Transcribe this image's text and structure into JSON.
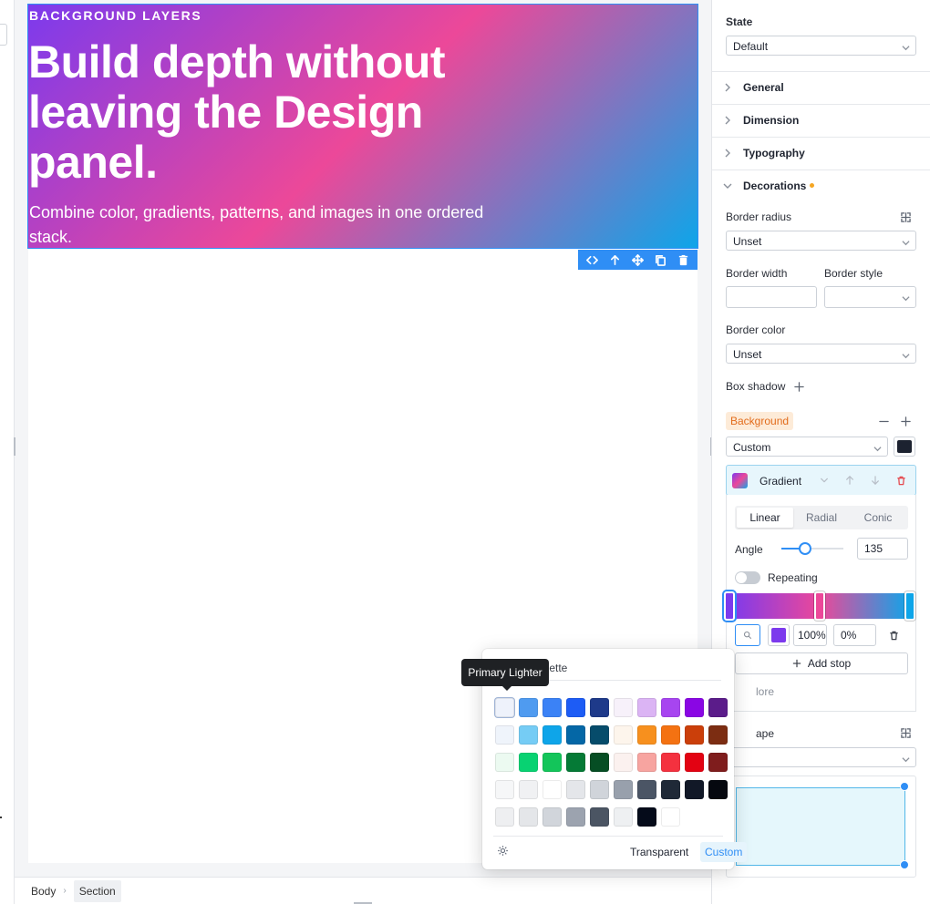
{
  "hero": {
    "eyebrow": "BACKGROUND LAYERS",
    "headline": "Build depth without leaving the Design panel.",
    "subtext": "Combine color, gradients, patterns, and images in one ordered stack."
  },
  "element_toolbar": {
    "icons": [
      "code-icon",
      "arrow-up-icon",
      "move-icon",
      "duplicate-icon",
      "trash-icon"
    ]
  },
  "breadcrumb": {
    "items": [
      "Body",
      "Section"
    ]
  },
  "panel": {
    "state": {
      "label": "State",
      "value": "Default"
    },
    "sections": {
      "general": "General",
      "dimension": "Dimension",
      "typography": "Typography",
      "decorations": "Decorations"
    },
    "border_radius": {
      "label": "Border radius",
      "value": "Unset"
    },
    "border_width": {
      "label": "Border width",
      "value": ""
    },
    "border_style": {
      "label": "Border style",
      "value": ""
    },
    "border_color": {
      "label": "Border color",
      "value": "Unset"
    },
    "box_shadow": {
      "label": "Box shadow"
    },
    "background": {
      "label": "Background",
      "mode": "Custom",
      "swatch_color": "#1c2230",
      "layer": {
        "name": "Gradient",
        "type_tabs": [
          "Linear",
          "Radial",
          "Conic"
        ],
        "active_type": "Linear",
        "angle_label": "Angle",
        "angle": "135",
        "repeating_label": "Repeating",
        "repeating": false,
        "stops": [
          {
            "color": "#7c3aed",
            "position": 0
          },
          {
            "color": "#ec4899",
            "position": 50
          },
          {
            "color": "#0ea5e9",
            "position": 100
          }
        ],
        "selected_stop": {
          "color": "#7c3aed",
          "opacity": "100%",
          "position": "0%"
        },
        "add_stop_label": "Add stop",
        "more_label": "lore"
      }
    },
    "shape": {
      "label": "ape"
    }
  },
  "palette": {
    "title": "alette",
    "tooltip": "Primary Lighter",
    "rows": [
      [
        "#eef2fb",
        "#4f9bf0",
        "#3b82f6",
        "#1d5cf5",
        "#1e3a8a",
        "#f7f1fa",
        "#dbb4f4",
        "#a745f0",
        "#8a06e4",
        "#5b1c8a"
      ],
      [
        "#eff4fb",
        "#75ccf5",
        "#0ea5e9",
        "#0467a6",
        "#064c6b",
        "#fdf5ec",
        "#f7901e",
        "#f47212",
        "#cb3f0a",
        "#7c2d12"
      ],
      [
        "#ecfaf1",
        "#08d272",
        "#13c55a",
        "#057a36",
        "#064e24",
        "#fbf1ef",
        "#f7a4a0",
        "#f4313f",
        "#e30212",
        "#7f1d1d"
      ],
      [
        "#f6f7f8",
        "#f0f1f3",
        "#ffffff",
        "#e4e6ea",
        "#d0d4da",
        "#98a0ac",
        "#4b5565",
        "#1f2937",
        "#111827",
        "#05080f"
      ],
      [
        "#eeeff1",
        "#e4e6e9",
        "#d1d5db",
        "#9ca3af",
        "#4b5563",
        "#eef0f2",
        "#050b1a",
        "#ffffff"
      ]
    ],
    "transparent_label": "Transparent",
    "custom_label": "Custom"
  }
}
